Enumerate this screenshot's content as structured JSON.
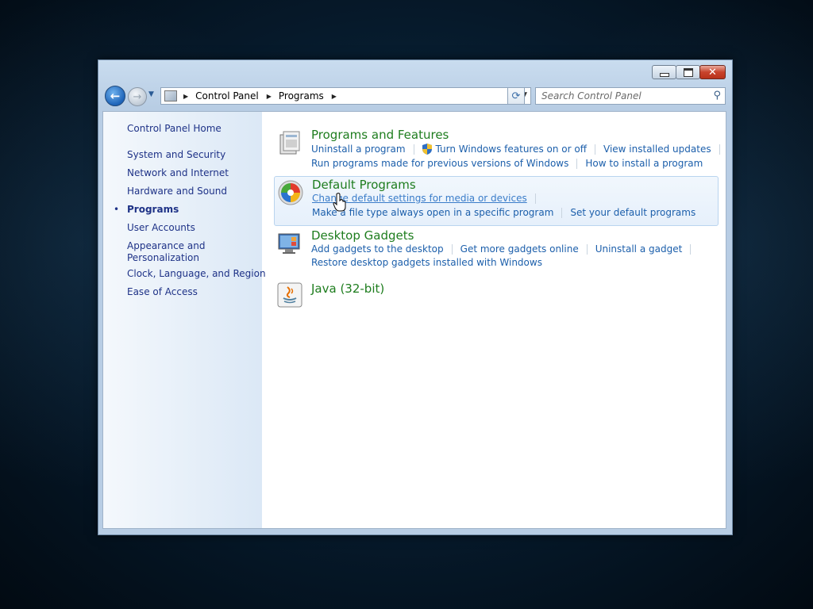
{
  "window": {
    "caption": {
      "minimize": "",
      "maximize": "",
      "close": "✕"
    }
  },
  "nav": {
    "back_glyph": "←",
    "forward_glyph": "→",
    "recent_glyph": "▼",
    "breadcrumbs": [
      "Control Panel",
      "Programs"
    ],
    "crumb_separator": "▶",
    "dropdown_glyph": "▼",
    "refresh_glyph": "⟳",
    "search_placeholder": "Search Control Panel",
    "search_glyph": "⚲"
  },
  "sidebar": {
    "home": "Control Panel Home",
    "current_bullet": "•",
    "items": [
      {
        "label": "System and Security",
        "current": false
      },
      {
        "label": "Network and Internet",
        "current": false
      },
      {
        "label": "Hardware and Sound",
        "current": false
      },
      {
        "label": "Programs",
        "current": true
      },
      {
        "label": "User Accounts",
        "current": false
      },
      {
        "label": "Appearance and\nPersonalization",
        "current": false
      },
      {
        "label": "Clock, Language, and Region",
        "current": false
      },
      {
        "label": "Ease of Access",
        "current": false
      }
    ]
  },
  "categories": [
    {
      "title": "Programs and Features",
      "icon": "programs-features-icon",
      "links": [
        [
          "Uninstall a program",
          "Turn Windows features on or off",
          "View installed updates"
        ],
        [
          "Run programs made for previous versions of Windows",
          "How to install a program"
        ]
      ]
    },
    {
      "title": "Default Programs",
      "icon": "default-programs-icon",
      "highlighted": true,
      "links": [
        [
          "Change default settings for media or devices"
        ],
        [
          "Make a file type always open in a specific program",
          "Set your default programs"
        ]
      ]
    },
    {
      "title": "Desktop Gadgets",
      "icon": "desktop-gadgets-icon",
      "links": [
        [
          "Add gadgets to the desktop",
          "Get more gadgets online",
          "Uninstall a gadget"
        ],
        [
          "Restore desktop gadgets installed with Windows"
        ]
      ]
    },
    {
      "title": "Java (32-bit)",
      "icon": "java-icon",
      "links": []
    }
  ],
  "colors": {
    "category_title": "#1e7d1e",
    "task_link": "#1c5fab",
    "sidebar_link": "#1e3287"
  }
}
